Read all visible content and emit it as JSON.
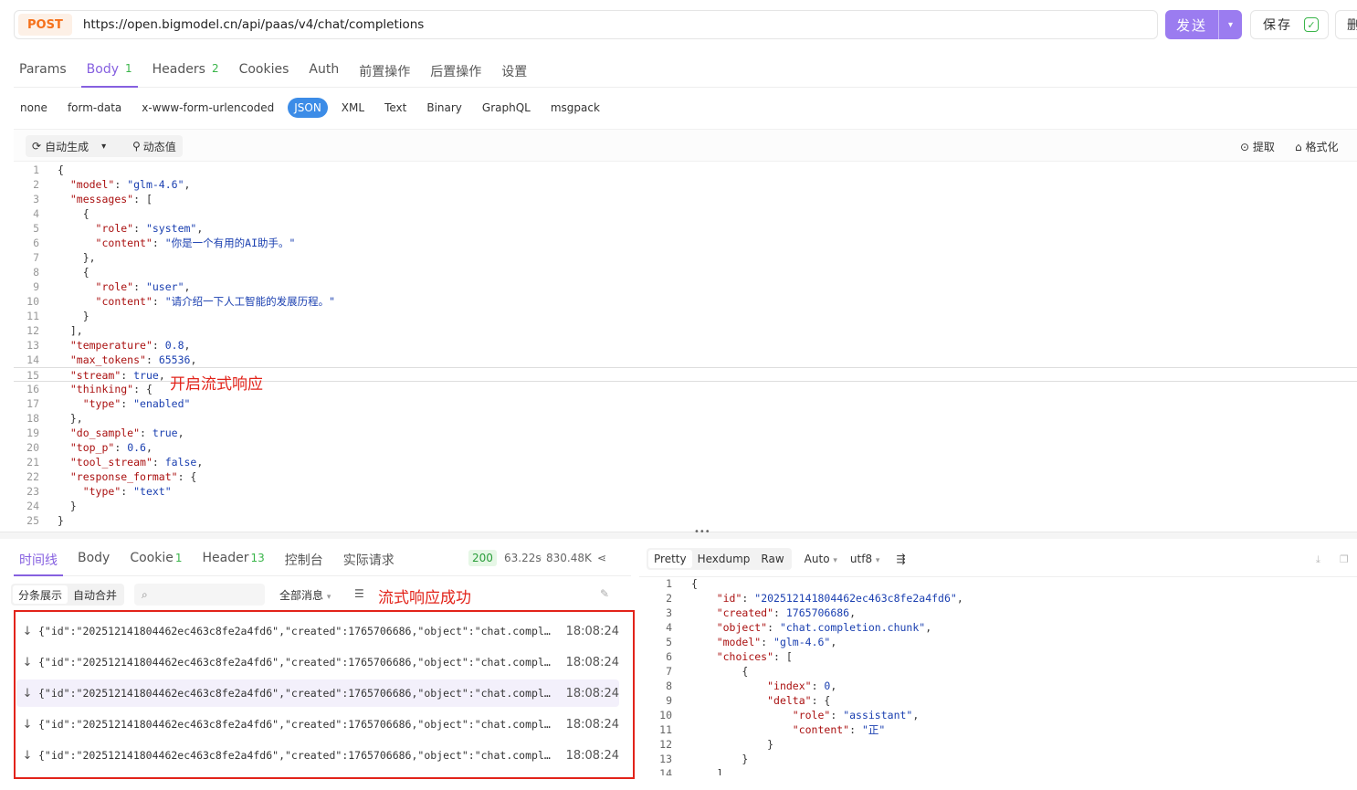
{
  "request": {
    "method": "POST",
    "url": "https://open.bigmodel.cn/api/paas/v4/chat/completions",
    "send_label": "发送",
    "save_label": "保存",
    "delete_label": "删"
  },
  "req_tabs": [
    {
      "label": "Params",
      "count": ""
    },
    {
      "label": "Body",
      "count": "1"
    },
    {
      "label": "Headers",
      "count": "2"
    },
    {
      "label": "Cookies",
      "count": ""
    },
    {
      "label": "Auth",
      "count": ""
    },
    {
      "label": "前置操作",
      "count": ""
    },
    {
      "label": "后置操作",
      "count": ""
    },
    {
      "label": "设置",
      "count": ""
    }
  ],
  "active_req_tab": "Body",
  "body_types": [
    "none",
    "form-data",
    "x-www-form-urlencoded",
    "JSON",
    "XML",
    "Text",
    "Binary",
    "GraphQL",
    "msgpack"
  ],
  "active_body_type": "JSON",
  "editor_toolbar": {
    "auto_generate": "自动生成",
    "dynamic_value": "动态值",
    "extract": "提取",
    "format": "格式化"
  },
  "editor_lines": [
    "{",
    "  \"model\": \"glm-4.6\",",
    "  \"messages\": [",
    "    {",
    "      \"role\": \"system\",",
    "      \"content\": \"你是一个有用的AI助手。\"",
    "    },",
    "    {",
    "      \"role\": \"user\",",
    "      \"content\": \"请介绍一下人工智能的发展历程。\"",
    "    }",
    "  ],",
    "  \"temperature\": 0.8,",
    "  \"max_tokens\": 65536,",
    "  \"stream\": true,",
    "  \"thinking\": {",
    "    \"type\": \"enabled\"",
    "  },",
    "  \"do_sample\": true,",
    "  \"top_p\": 0.6,",
    "  \"tool_stream\": false,",
    "  \"response_format\": {",
    "    \"type\": \"text\"",
    "  }",
    "}"
  ],
  "annotation_stream": "开启流式响应",
  "response": {
    "tabs": [
      {
        "label": "时间线",
        "count": ""
      },
      {
        "label": "Body",
        "count": ""
      },
      {
        "label": "Cookie",
        "count": "1"
      },
      {
        "label": "Header",
        "count": "13"
      },
      {
        "label": "控制台",
        "count": ""
      },
      {
        "label": "实际请求",
        "count": ""
      }
    ],
    "active_tab": "时间线",
    "status_code": "200",
    "time": "63.22s",
    "size": "830.48K",
    "view_modes": [
      "分条展示",
      "自动合并"
    ],
    "all_messages": "全部消息",
    "annotation_success": "流式响应成功",
    "messages": [
      {
        "text": "{\"id\":\"202512141804462ec463c8fe2a4fd6\",\"created\":1765706686,\"object\":\"chat.completion.chunk\"",
        "time": "18:08:24"
      },
      {
        "text": "{\"id\":\"202512141804462ec463c8fe2a4fd6\",\"created\":1765706686,\"object\":\"chat.completion.chunk\"",
        "time": "18:08:24"
      },
      {
        "text": "{\"id\":\"202512141804462ec463c8fe2a4fd6\",\"created\":1765706686,\"object\":\"chat.completion.chunk\"",
        "time": "18:08:24"
      },
      {
        "text": "{\"id\":\"202512141804462ec463c8fe2a4fd6\",\"created\":1765706686,\"object\":\"chat.completion.chunk\"",
        "time": "18:08:24"
      },
      {
        "text": "{\"id\":\"202512141804462ec463c8fe2a4fd6\",\"created\":1765706686,\"object\":\"chat.completion.chunk\"",
        "time": "18:08:24"
      }
    ],
    "selected_message_index": 2,
    "viewer_tabs": [
      "Pretty",
      "Hexdump",
      "Raw"
    ],
    "viewer_format": "Auto",
    "viewer_encoding": "utf8",
    "viewer_lines": [
      "{",
      "    \"id\": \"202512141804462ec463c8fe2a4fd6\",",
      "    \"created\": 1765706686,",
      "    \"object\": \"chat.completion.chunk\",",
      "    \"model\": \"glm-4.6\",",
      "    \"choices\": [",
      "        {",
      "            \"index\": 0,",
      "            \"delta\": {",
      "                \"role\": \"assistant\",",
      "                \"content\": \"正\"",
      "            }",
      "        }",
      "    ],"
    ]
  },
  "colors": {
    "accent": "#8660e0",
    "send_button": "#9b7cf0",
    "method": "#f5701a",
    "json_active": "#3c8ce7",
    "annotation": "#e2231a",
    "success": "#3ab54a"
  },
  "icons": [
    "refresh-icon",
    "chevron-down-icon",
    "wand-icon",
    "extract-icon",
    "format-icon",
    "share-icon",
    "search-icon",
    "filter-icon",
    "broom-icon",
    "arrow-down-icon",
    "wrap-icon",
    "download-icon",
    "copy-icon",
    "check-icon"
  ]
}
